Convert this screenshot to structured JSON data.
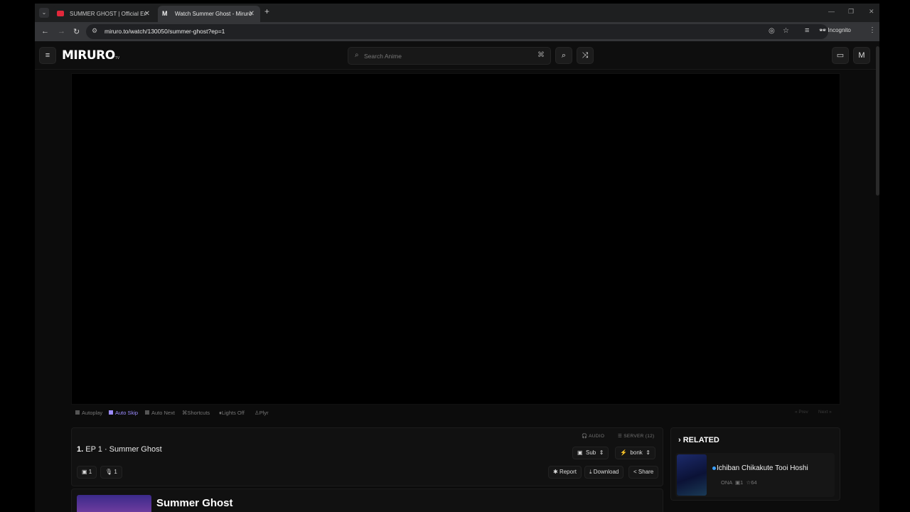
{
  "browser": {
    "tabs": [
      {
        "title": "SUMMER GHOST | Official Engli",
        "favicon": "youtube-icon"
      },
      {
        "title": "Watch Summer Ghost - Miruro",
        "favicon": "miruro-icon"
      }
    ],
    "url": "miruro.to/watch/130050/summer-ghost?ep=1",
    "incognito_label": "Incognito"
  },
  "site": {
    "logo": "MIRURO",
    "logo_suffix": "TV",
    "search_placeholder": "Search Anime",
    "avatar_letter": "M"
  },
  "player_options": [
    {
      "label": "Autoplay",
      "active": false
    },
    {
      "label": "Auto Skip",
      "active": true
    },
    {
      "label": "Auto Next",
      "active": false
    },
    {
      "label": "Shortcuts",
      "active": false
    },
    {
      "label": "Lights Off",
      "active": false
    },
    {
      "label": "Plyr",
      "active": false
    }
  ],
  "player_nav": {
    "prev": "Prev",
    "next": "Next"
  },
  "episode": {
    "number": "1.",
    "label": "EP 1 · Summer Ghost",
    "sub_count": "1",
    "dub_count": "1",
    "audio_label": "AUDIO",
    "server_label": "SERVER (12)",
    "audio_value": "Sub",
    "server_value": "bonk",
    "report": "Report",
    "download": "Download",
    "share": "Share"
  },
  "related": {
    "heading": "RELATED",
    "items": [
      {
        "title": "Ichiban Chikakute Tooi Hoshi",
        "format": "ONA",
        "episodes": "1",
        "score": "64"
      }
    ]
  },
  "anime": {
    "title": "Summer Ghost"
  },
  "colors": {
    "accent": "#9c8cff",
    "status_dot": "#3aa0ff",
    "youtube": "#e2283b"
  }
}
